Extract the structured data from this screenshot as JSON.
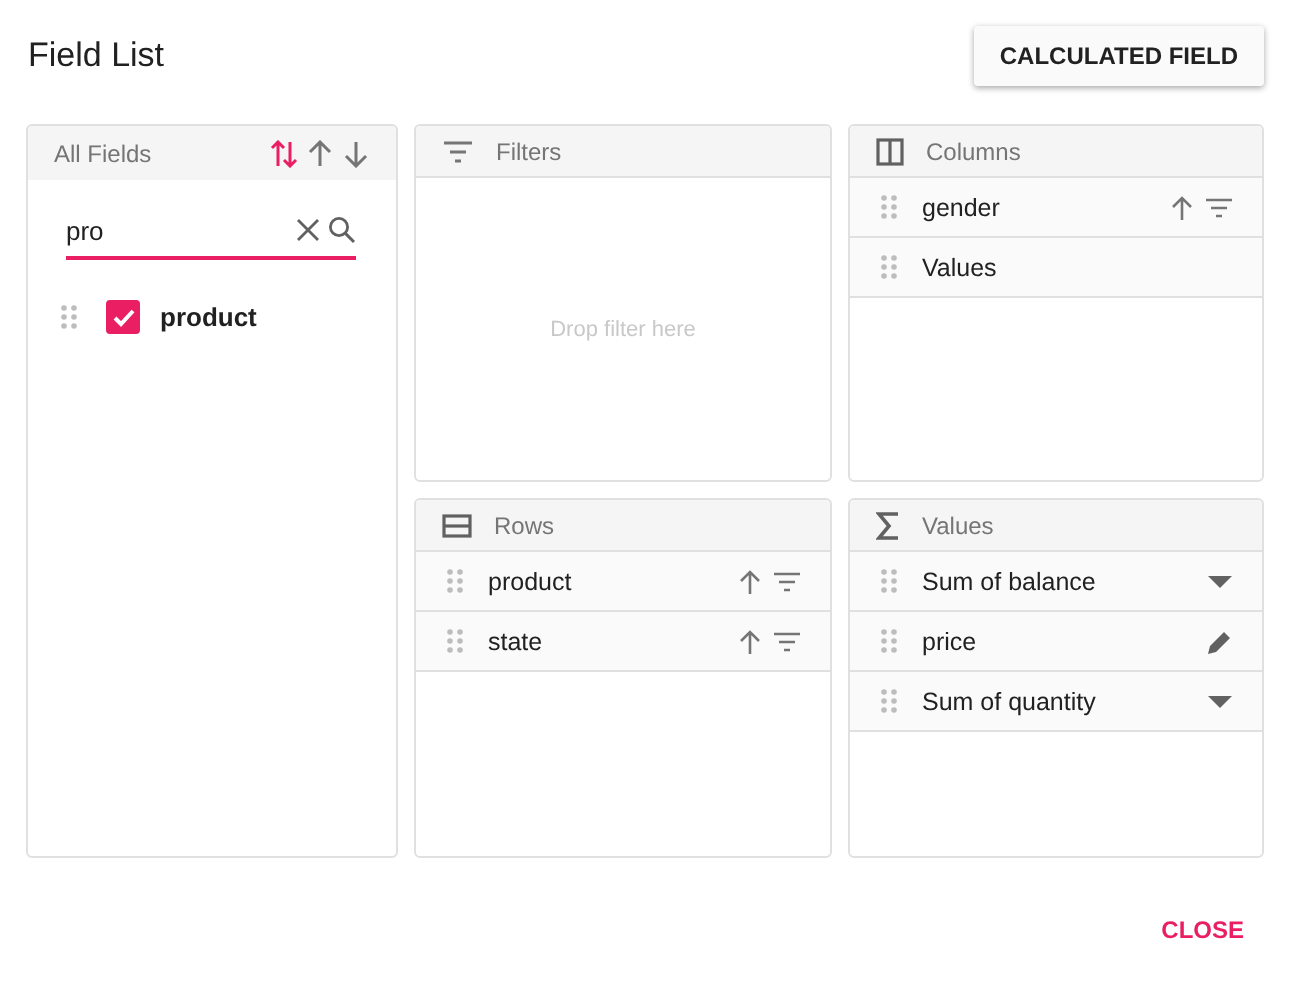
{
  "dialog": {
    "title": "Field List",
    "action_button": "CALCULATED FIELD",
    "footer_button": "CLOSE"
  },
  "all_fields": {
    "title": "All Fields",
    "sort_options": [
      {
        "kind": "default",
        "selected": true
      },
      {
        "kind": "ascending",
        "selected": false
      },
      {
        "kind": "descending",
        "selected": false
      }
    ],
    "search": {
      "value": "pro"
    },
    "fields": [
      {
        "name": "product",
        "checked": true
      }
    ]
  },
  "filters": {
    "title": "Filters",
    "placeholder": "Drop filter here"
  },
  "columns": {
    "title": "Columns",
    "items": [
      {
        "name": "gender",
        "kind": "sortable"
      },
      {
        "name": "Values",
        "kind": "plain"
      }
    ]
  },
  "rows": {
    "title": "Rows",
    "items": [
      {
        "name": "product",
        "kind": "sortable"
      },
      {
        "name": "state",
        "kind": "sortable"
      }
    ]
  },
  "values": {
    "title": "Values",
    "items": [
      {
        "name": "Sum of balance",
        "kind": "dropdown"
      },
      {
        "name": "price",
        "kind": "edit"
      },
      {
        "name": "Sum of quantity",
        "kind": "dropdown"
      }
    ]
  }
}
